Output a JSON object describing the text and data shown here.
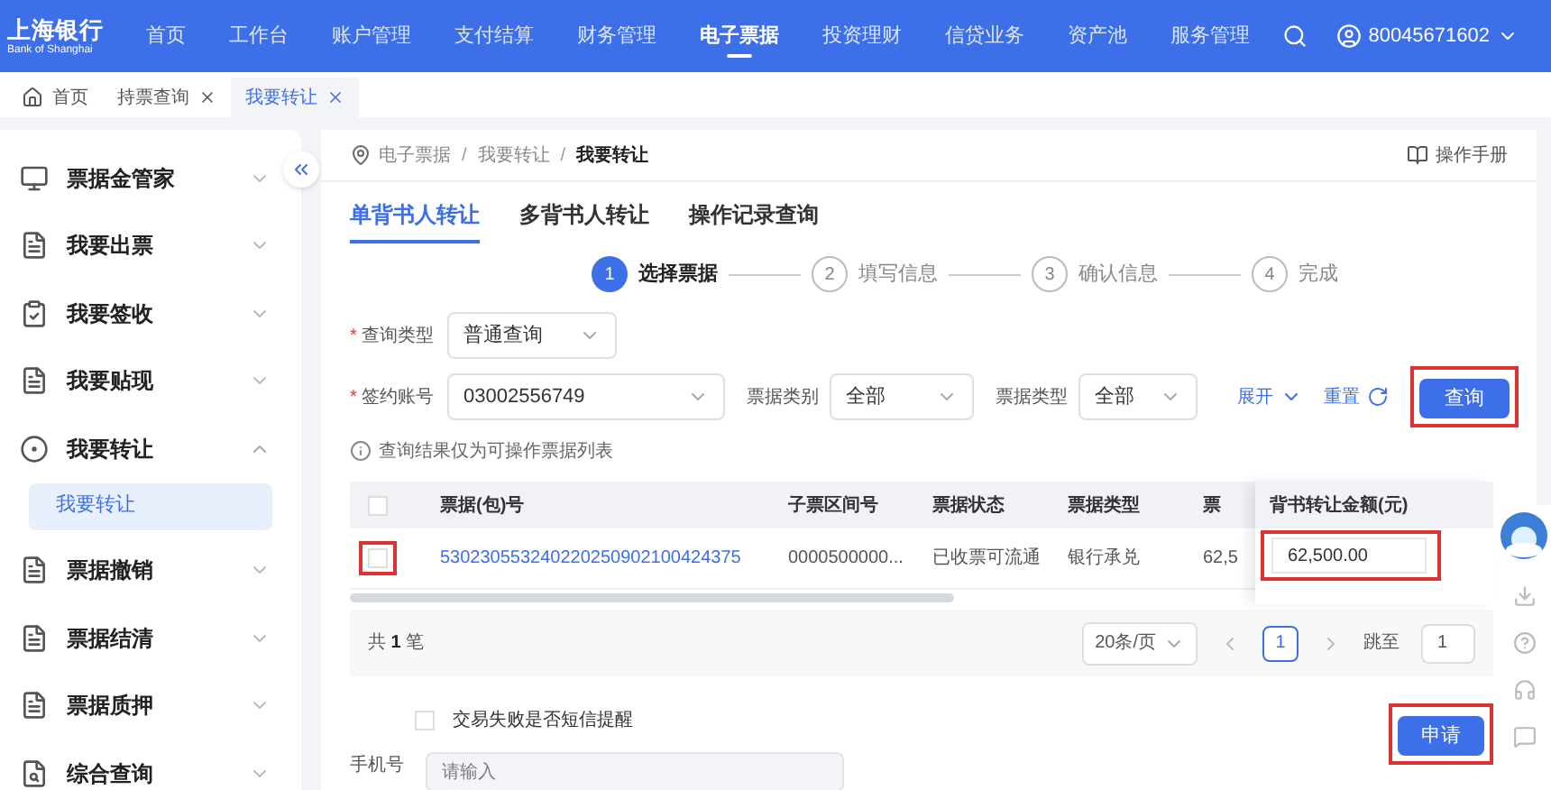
{
  "brand": {
    "name": "上海银行",
    "subtitle": "Bank of Shanghai"
  },
  "nav": [
    {
      "label": "首页",
      "selected": false
    },
    {
      "label": "工作台",
      "selected": false
    },
    {
      "label": "账户管理",
      "selected": false
    },
    {
      "label": "支付结算",
      "selected": false
    },
    {
      "label": "财务管理",
      "selected": false
    },
    {
      "label": "电子票据",
      "selected": true
    },
    {
      "label": "投资理财",
      "selected": false
    },
    {
      "label": "信贷业务",
      "selected": false
    },
    {
      "label": "资产池",
      "selected": false
    },
    {
      "label": "服务管理",
      "selected": false
    }
  ],
  "user": {
    "account": "80045671602"
  },
  "page_tabs": [
    {
      "label": "首页",
      "kind": "home",
      "selected": false
    },
    {
      "label": "持票查询",
      "kind": "closable",
      "selected": false
    },
    {
      "label": "我要转让",
      "kind": "closable",
      "selected": true
    }
  ],
  "sidebar": {
    "items": [
      {
        "label": "票据金管家",
        "expanded": false
      },
      {
        "label": "我要出票",
        "expanded": false
      },
      {
        "label": "我要签收",
        "expanded": false
      },
      {
        "label": "我要贴现",
        "expanded": false
      },
      {
        "label": "我要转让",
        "expanded": true,
        "children": [
          {
            "label": "我要转让",
            "selected": true
          }
        ]
      },
      {
        "label": "票据撤销",
        "expanded": false
      },
      {
        "label": "票据结清",
        "expanded": false
      },
      {
        "label": "票据质押",
        "expanded": false
      },
      {
        "label": "综合查询",
        "expanded": false
      }
    ]
  },
  "breadcrumb": [
    {
      "label": "电子票据"
    },
    {
      "separator": "/",
      "label": "我要转让"
    },
    {
      "separator": "/",
      "label": "我要转让"
    }
  ],
  "manual_link": "操作手册",
  "tabs": [
    {
      "label": "单背书人转让",
      "selected": true
    },
    {
      "label": "多背书人转让",
      "selected": false
    },
    {
      "label": "操作记录查询",
      "selected": false
    }
  ],
  "steps": [
    {
      "number": "1",
      "label": "选择票据",
      "selected": true
    },
    {
      "number": "2",
      "label": "填写信息",
      "selected": false
    },
    {
      "number": "3",
      "label": "确认信息",
      "selected": false
    },
    {
      "number": "4",
      "label": "完成",
      "selected": false
    }
  ],
  "form": {
    "query_type": {
      "required_mark": "*",
      "label": "查询类型",
      "value": "普通查询"
    },
    "account": {
      "required_mark": "*",
      "label": "签约账号",
      "value": "03002556749"
    },
    "bill_category": {
      "label": "票据类别",
      "value": "全部"
    },
    "bill_type": {
      "label": "票据类型",
      "value": "全部"
    },
    "expand": "展开",
    "reset": "重置",
    "query": "查询"
  },
  "notice": "查询结果仅为可操作票据列表",
  "table": {
    "columns": [
      "票据(包)号",
      "子票区间号",
      "票据状态",
      "票据类型",
      "票"
    ],
    "fixed_column": "背书转让金额(元)",
    "select_all_checked": false,
    "rows": [
      {
        "checked": false,
        "cells": [
          "530230553240220250902100424375",
          "0000500000...",
          "已收票可流通",
          "银行承兑",
          "62,5"
        ],
        "amount": "62,500.00"
      }
    ]
  },
  "pagination": {
    "total_prefix": "共",
    "total": "1",
    "total_suffix": "笔",
    "page_size": "20条/页",
    "pages": [
      {
        "label": "1",
        "selected": true
      }
    ],
    "jump_label": "跳至",
    "jump_value": "1"
  },
  "sms": {
    "label": "交易失败是否短信提醒",
    "checked": false
  },
  "apply": "申请",
  "phone": {
    "label": "手机号",
    "placeholder": "请输入"
  }
}
